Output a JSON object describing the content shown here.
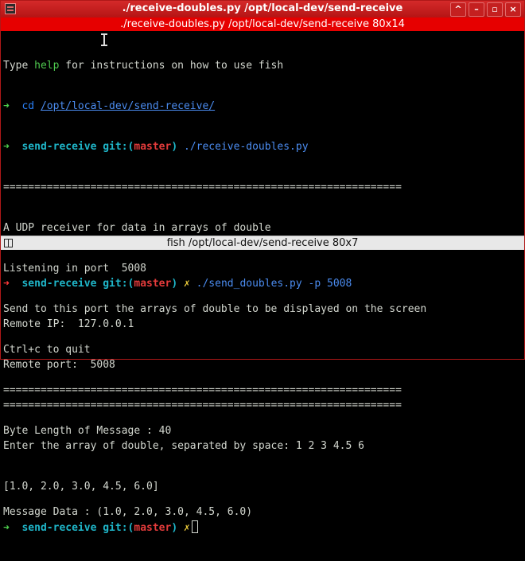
{
  "window": {
    "title": "./receive-doubles.py  /opt/local-dev/send-receive",
    "buttons": {
      "keep_above": "^",
      "minimize": "–",
      "maximize": "▫",
      "close": "×"
    }
  },
  "top_tab": {
    "label": "./receive-doubles.py  /opt/local-dev/send-receive 80x14"
  },
  "bottom_tab": {
    "label": "fish  /opt/local-dev/send-receive 80x7"
  },
  "top_pane": {
    "greeting_before": "Type ",
    "greeting_cmd": "help",
    "greeting_after": " for instructions on how to use fish",
    "arrow": "➜",
    "cd_cmd": "cd",
    "cd_path": "/opt/local-dev/send-receive/",
    "prompt_dir": "send-receive",
    "prompt_git": "git:(",
    "prompt_branch": "master",
    "prompt_git_close": ")",
    "run_cmd": "./receive-doubles.py",
    "separator": "================================================================",
    "desc": "A UDP receiver for data in arrays of double",
    "listening": "Listening in port  5008",
    "send_info": "Send to this port the arrays of double to be displayed on the screen",
    "quit_info": "Ctrl+c to quit",
    "byte_length": "Byte Length of Message : 40",
    "message_data": "Message Data : (1.0, 2.0, 3.0, 4.5, 6.0)"
  },
  "bottom_pane": {
    "arrow": "➜",
    "prompt_dir": "send-receive",
    "prompt_git": "git:(",
    "prompt_branch": "master",
    "prompt_git_close": ")",
    "dirty": "✗",
    "send_cmd": "./send_doubles.py -p 5008",
    "remote_ip": "Remote IP:  127.0.0.1",
    "remote_port": "Remote port:  5008",
    "separator": "================================================================",
    "enter_prompt": "Enter the array of double, separated by space: 1 2 3 4.5 6",
    "echo": "[1.0, 2.0, 3.0, 4.5, 6.0]"
  },
  "colors": {
    "title_bar": "#c31a1a",
    "active_tab": "#e60000",
    "prompt_dir": "#1fb6c9",
    "branch": "#e43b3b",
    "arrow_ok": "#4ed24e",
    "arrow_fail": "#ff3b3b"
  }
}
